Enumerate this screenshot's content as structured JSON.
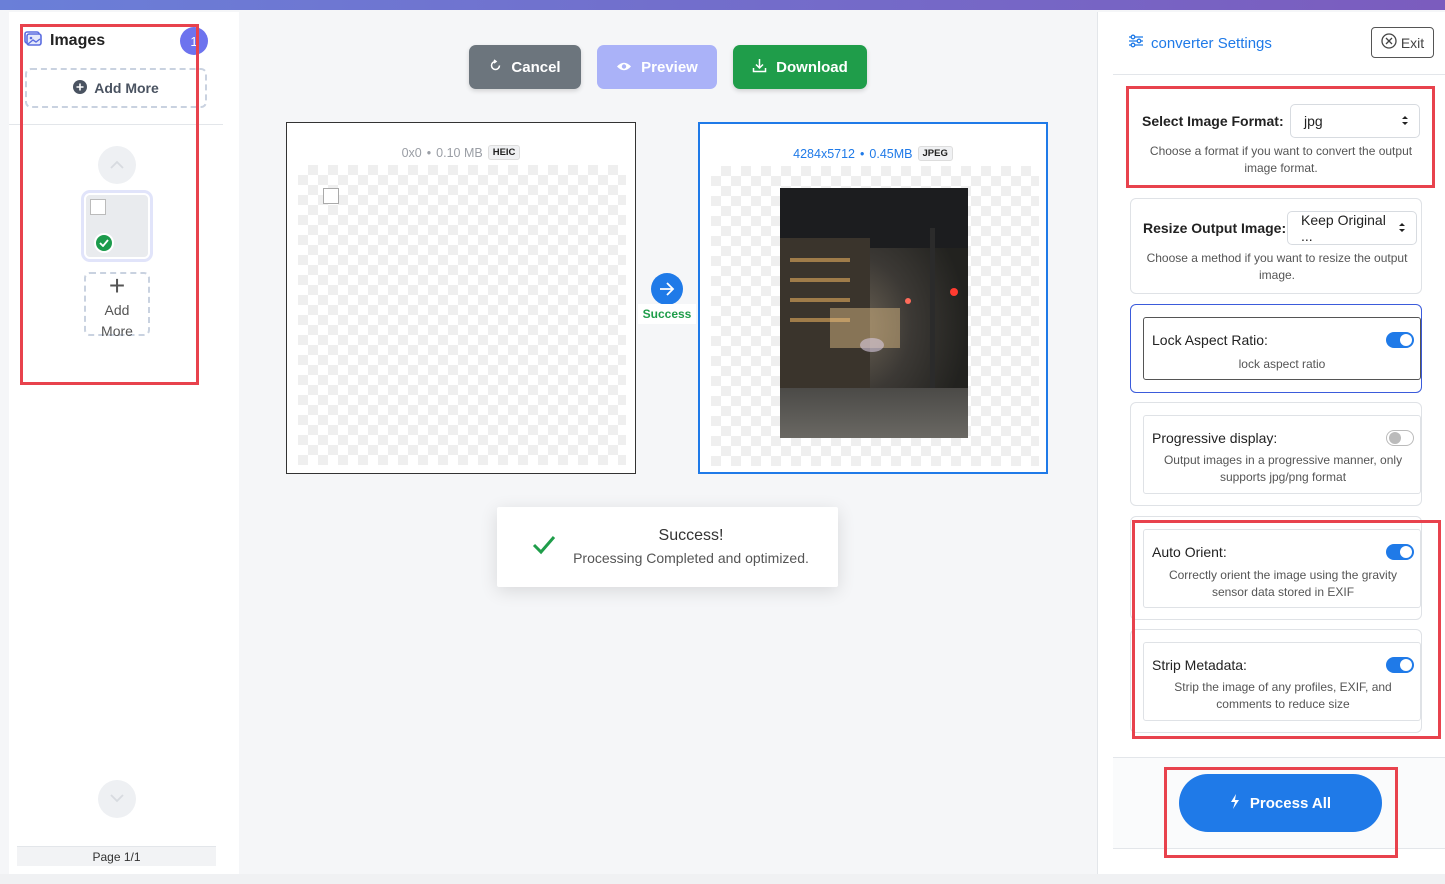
{
  "sidebar": {
    "title": "Images",
    "badge_count": "1",
    "add_more_label": "Add More",
    "add_tile_line1": "Add",
    "add_tile_line2": "More",
    "page_label": "Page 1/1"
  },
  "actions": {
    "cancel_label": "Cancel",
    "preview_label": "Preview",
    "download_label": "Download"
  },
  "source": {
    "dimensions": "0x0",
    "size": "0.10 MB",
    "format": "HEIC"
  },
  "output": {
    "dimensions": "4284x5712",
    "size": "0.45MB",
    "format": "JPEG"
  },
  "status_label": "Success",
  "toast": {
    "title": "Success!",
    "message": "Processing Completed and optimized."
  },
  "settings": {
    "title": "converter Settings",
    "exit_label": "Exit",
    "format": {
      "label": "Select Image Format:",
      "value": "jpg",
      "desc": "Choose a format if you want to convert the output image format."
    },
    "resize": {
      "label": "Resize Output Image:",
      "value": "Keep Original ...",
      "desc": "Choose a method if you want to resize the output image."
    },
    "lock_aspect": {
      "label": "Lock Aspect Ratio:",
      "desc": "lock aspect ratio",
      "enabled": true
    },
    "progressive": {
      "label": "Progressive display:",
      "desc": "Output images in a progressive manner, only supports jpg/png format",
      "enabled": false
    },
    "auto_orient": {
      "label": "Auto Orient:",
      "desc": "Correctly orient the image using the gravity sensor data stored in EXIF",
      "enabled": true
    },
    "strip_metadata": {
      "label": "Strip Metadata:",
      "desc": "Strip the image of any profiles, EXIF, and comments to reduce size",
      "enabled": true
    },
    "process_label": "Process All"
  },
  "colors": {
    "accent": "#1f7ae8",
    "success": "#1f9d4a",
    "annotation": "#e8424d",
    "badge": "#6d73ee"
  }
}
